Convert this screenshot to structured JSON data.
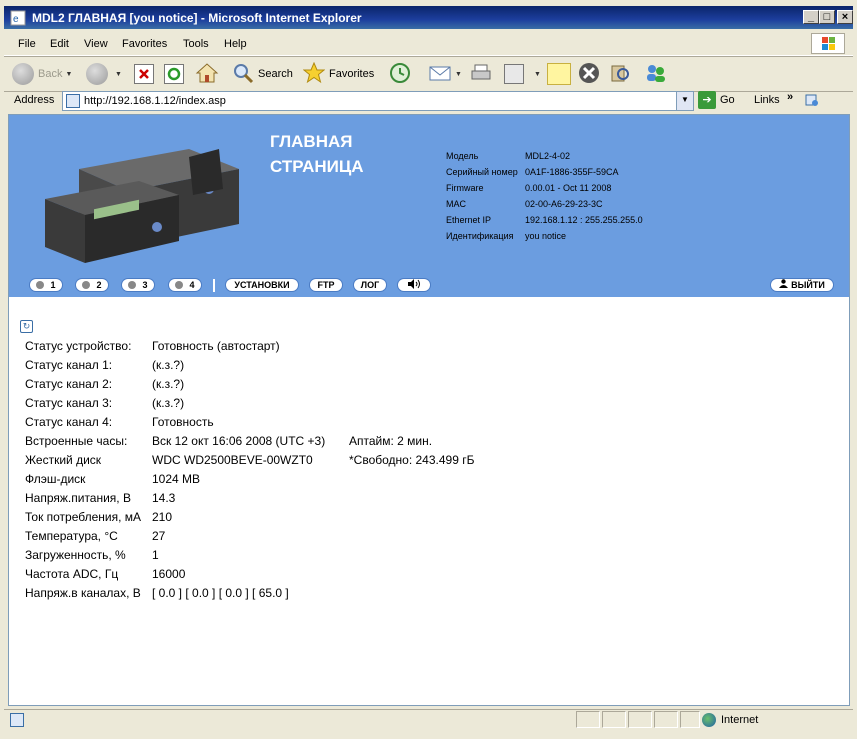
{
  "window": {
    "title": "MDL2 ГЛАВНАЯ [you notice] - Microsoft Internet Explorer"
  },
  "menu": [
    "File",
    "Edit",
    "View",
    "Favorites",
    "Tools",
    "Help"
  ],
  "toolbar": {
    "back": "Back",
    "search": "Search",
    "favorites": "Favorites"
  },
  "address": {
    "label": "Address",
    "url": "http://192.168.1.12/index.asp",
    "go": "Go",
    "links": "Links",
    "more": "»"
  },
  "header": {
    "title_line1": "ГЛАВНАЯ",
    "title_line2": "СТРАНИЦА",
    "info": [
      {
        "label": "Модель",
        "value": "MDL2-4-02"
      },
      {
        "label": "Серийный номер",
        "value": "0A1F-1886-355F-59CA"
      },
      {
        "label": "Firmware",
        "value": "0.00.01 - Oct 11 2008"
      },
      {
        "label": "MAC",
        "value": "02-00-A6-29-23-3C"
      },
      {
        "label": "Ethernet IP",
        "value": "192.168.1.12 : 255.255.255.0"
      },
      {
        "label": "Идентификация",
        "value": "you notice"
      }
    ]
  },
  "nav": {
    "ch1": "1",
    "ch2": "2",
    "ch3": "3",
    "ch4": "4",
    "settings": "УСТАНОВКИ",
    "ftp": "FTP",
    "log": "ЛОГ",
    "sound": "◀))",
    "logout": "ВЫЙТИ"
  },
  "status": [
    {
      "label": "Статус устройство:",
      "value": "Готовность (автостарт)",
      "extra": ""
    },
    {
      "label": "Статус канал 1:",
      "value": "(к.з.?)",
      "extra": ""
    },
    {
      "label": "Статус канал 2:",
      "value": "(к.з.?)",
      "extra": ""
    },
    {
      "label": "Статус канал 3:",
      "value": "(к.з.?)",
      "extra": ""
    },
    {
      "label": "Статус канал 4:",
      "value": "Готовность",
      "extra": ""
    },
    {
      "label": "Встроенные часы:",
      "value": "Вск 12 окт 16:06 2008  (UTC +3)",
      "extra": "Аптайм: 2 мин."
    },
    {
      "label": "Жесткий диск",
      "value": "WDC WD2500BEVE-00WZT0",
      "extra": "*Свободно: 243.499 гБ"
    },
    {
      "label": "Флэш-диск",
      "value": "1024 MB",
      "extra": ""
    },
    {
      "label": "Напряж.питания, В",
      "value": "14.3",
      "extra": ""
    },
    {
      "label": "Ток потребления, мА",
      "value": "210",
      "extra": ""
    },
    {
      "label": "Температура, °С",
      "value": "27",
      "extra": ""
    },
    {
      "label": "Загруженность, %",
      "value": "1",
      "extra": ""
    },
    {
      "label": "Частота ADC, Гц",
      "value": "16000",
      "extra": ""
    },
    {
      "label": "Напряж.в каналах, В",
      "value": "[ 0.0 ]  [ 0.0 ]  [ 0.0 ]  [ 65.0 ]",
      "extra": ""
    }
  ],
  "statusbar": {
    "zone": "Internet"
  },
  "colors": {
    "header_bg": "#6b9de0",
    "titlebar": "#0a246a"
  }
}
